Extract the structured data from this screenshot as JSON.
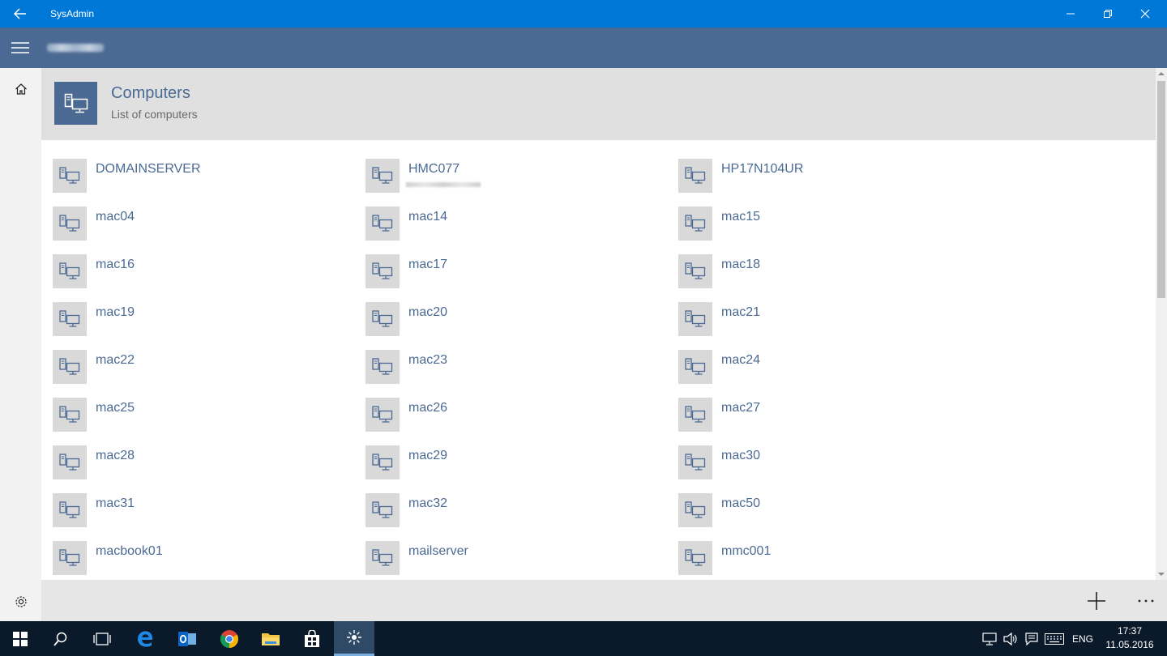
{
  "window": {
    "title": "SysAdmin",
    "controls": {
      "minimize": "minimize-icon",
      "maximize": "restore-icon",
      "close": "close-icon"
    }
  },
  "header": {
    "menu_icon": "hamburger-icon"
  },
  "page": {
    "title": "Computers",
    "subtitle": "List of computers",
    "icon": "computer-icon"
  },
  "computers": [
    {
      "name": "DOMAINSERVER"
    },
    {
      "name": "HMC077"
    },
    {
      "name": "HP17N104UR"
    },
    {
      "name": "mac04"
    },
    {
      "name": "mac14"
    },
    {
      "name": "mac15"
    },
    {
      "name": "mac16"
    },
    {
      "name": "mac17"
    },
    {
      "name": "mac18"
    },
    {
      "name": "mac19"
    },
    {
      "name": "mac20"
    },
    {
      "name": "mac21"
    },
    {
      "name": "mac22"
    },
    {
      "name": "mac23"
    },
    {
      "name": "mac24"
    },
    {
      "name": "mac25"
    },
    {
      "name": "mac26"
    },
    {
      "name": "mac27"
    },
    {
      "name": "mac28"
    },
    {
      "name": "mac29"
    },
    {
      "name": "mac30"
    },
    {
      "name": "mac31"
    },
    {
      "name": "mac32"
    },
    {
      "name": "mac50"
    },
    {
      "name": "macbook01"
    },
    {
      "name": "mailserver"
    },
    {
      "name": "mmc001"
    }
  ],
  "commandbar": {
    "add_icon": "plus-icon",
    "more_icon": "more-icon"
  },
  "taskbar": {
    "apps": [
      "windows-start-icon",
      "search-icon",
      "task-view-icon",
      "edge-icon",
      "outlook-icon",
      "chrome-icon",
      "file-explorer-icon",
      "store-icon",
      "sysadmin-app-icon"
    ],
    "language": "ENG",
    "time": "17:37",
    "date": "11.05.2016"
  },
  "colors": {
    "titlebar": "#0078d7",
    "accent": "#4b6a93",
    "tile": "#d9d9d9",
    "taskbar": "#0b1a2a"
  }
}
